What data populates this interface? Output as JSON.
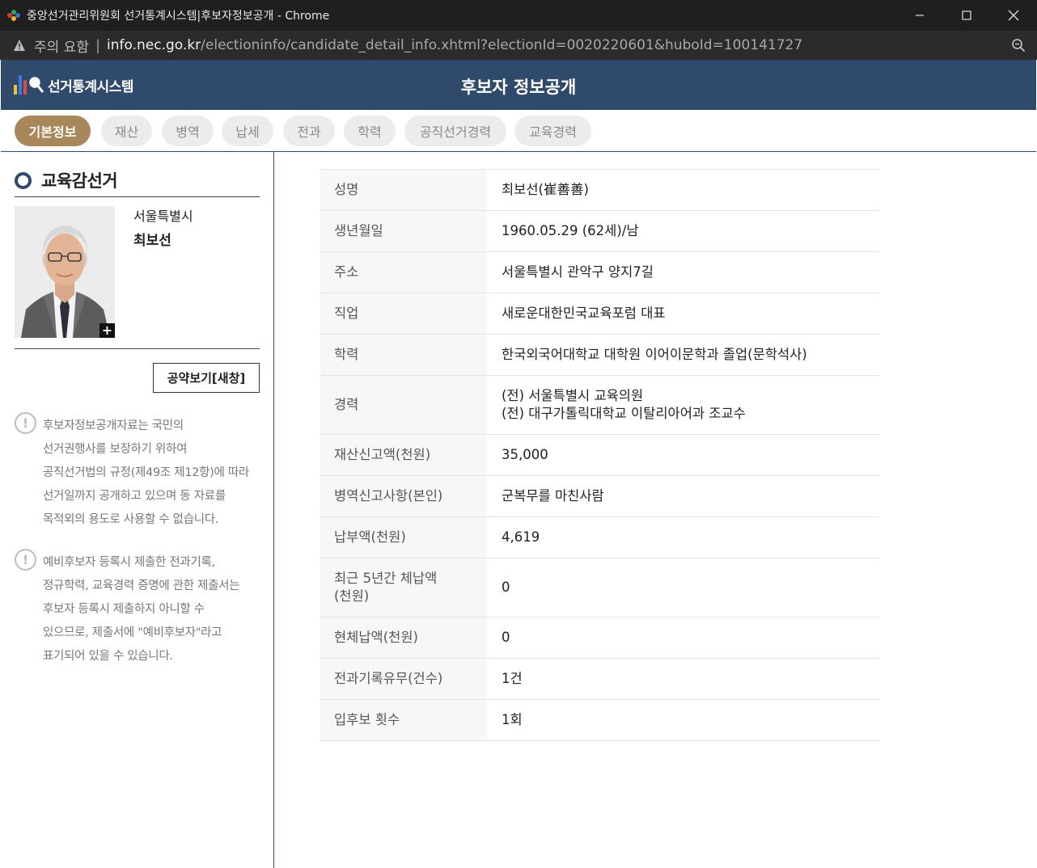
{
  "window": {
    "title": "중앙선거관리위원회 선거통계시스템|후보자정보공개 - Chrome",
    "minimize_glyph": "—",
    "maximize_glyph": "☐",
    "close_glyph": "✕"
  },
  "address_bar": {
    "warning": "주의 요함",
    "separator": "|",
    "host": "info.nec.go.kr",
    "path": "/electioninfo/candidate_detail_info.xhtml?electionId=0020220601&huboId=100141727"
  },
  "header": {
    "logo_text": "선거통계시스템",
    "page_title": "후보자 정보공개"
  },
  "tabs": [
    {
      "label": "기본정보",
      "active": true
    },
    {
      "label": "재산",
      "active": false
    },
    {
      "label": "병역",
      "active": false
    },
    {
      "label": "납세",
      "active": false
    },
    {
      "label": "전과",
      "active": false
    },
    {
      "label": "학력",
      "active": false
    },
    {
      "label": "공직선거경력",
      "active": false
    },
    {
      "label": "교육경력",
      "active": false
    }
  ],
  "sidebar": {
    "election_type": "교육감선거",
    "region": "서울특별시",
    "candidate_name": "최보선",
    "photo_plus": "+",
    "pledge_button": "공약보기[새창]",
    "notice_mark": "!",
    "notices": [
      "후보자정보공개자료는 국민의\n선거권행사를 보장하기 위하여\n공직선거법의 규정(제49조 제12항)에 따라\n선거일까지 공개하고 있으며 동 자료를\n목적외의 용도로 사용할 수 없습니다.",
      "예비후보자 등록시 제출한 전과기록,\n정규학력, 교육경력 증명에 관한 제출서는\n후보자 등록시 제출하지 아니할 수\n있으므로, 제출서에 \"예비후보자\"라고\n표기되어 있을 수 있습니다."
    ]
  },
  "info": [
    {
      "label": "성명",
      "value": "최보선(崔善善)"
    },
    {
      "label": "생년월일",
      "value": "1960.05.29 (62세)/남"
    },
    {
      "label": "주소",
      "value": "서울특별시 관악구 양지7길"
    },
    {
      "label": "직업",
      "value": "새로운대한민국교육포럼 대표"
    },
    {
      "label": "학력",
      "value": "한국외국어대학교 대학원 이어이문학과 졸업(문학석사)"
    },
    {
      "label": "경력",
      "value": "(전) 서울특별시 교육의원",
      "value2": "(전) 대구가톨릭대학교 이탈리아어과 조교수"
    },
    {
      "label": "재산신고액(천원)",
      "value": "35,000"
    },
    {
      "label": "병역신고사항(본인)",
      "value": "군복무를 마친사람"
    },
    {
      "label": "납부액(천원)",
      "value": "4,619"
    },
    {
      "label": "최근 5년간 체납액",
      "label2": "(천원)",
      "value": "0"
    },
    {
      "label": "현체납액(천원)",
      "value": "0"
    },
    {
      "label": "전과기록유무(건수)",
      "value": "1건"
    },
    {
      "label": "입후보 횟수",
      "value": "1회"
    }
  ],
  "colors": {
    "header_navy": "#2f4a6b",
    "tab_active": "#a8875a",
    "tab_inactive": "#ececec"
  }
}
